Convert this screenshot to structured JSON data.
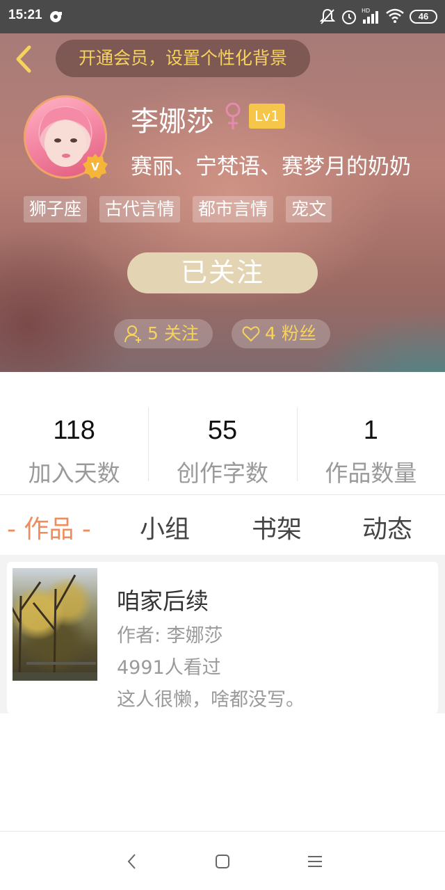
{
  "status_bar": {
    "time": "15:21",
    "battery": "46",
    "icons": [
      "music-app-icon",
      "mute-icon",
      "alarm-icon",
      "hd-signal-icon",
      "wifi-icon",
      "battery-icon"
    ]
  },
  "header": {
    "vip_banner": "开通会员，设置个性化背景"
  },
  "profile": {
    "nickname": "李娜莎",
    "level": "Lv1",
    "signature": "赛丽、宁梵语、赛梦月的奶奶",
    "tags": [
      "狮子座",
      "古代言情",
      "都市言情",
      "宠文"
    ],
    "follow_button": "已关注",
    "following_label": "5 关注",
    "fans_label": "4 粉丝"
  },
  "stats": [
    {
      "value": "118",
      "label": "加入天数"
    },
    {
      "value": "55",
      "label": "创作字数"
    },
    {
      "value": "1",
      "label": "作品数量"
    }
  ],
  "tabs": {
    "active": "- 作品 -",
    "group": "小组",
    "shelf": "书架",
    "feed": "动态"
  },
  "works": [
    {
      "title": "咱家后续",
      "author": "作者: 李娜莎",
      "views": "4991人看过",
      "description": "这人很懒，啥都没写。"
    }
  ],
  "colors": {
    "accent": "#ef8c5c",
    "gold": "#f6d35c",
    "level_badge": "#f5c64a",
    "follow_button": "#e3d5b4"
  }
}
